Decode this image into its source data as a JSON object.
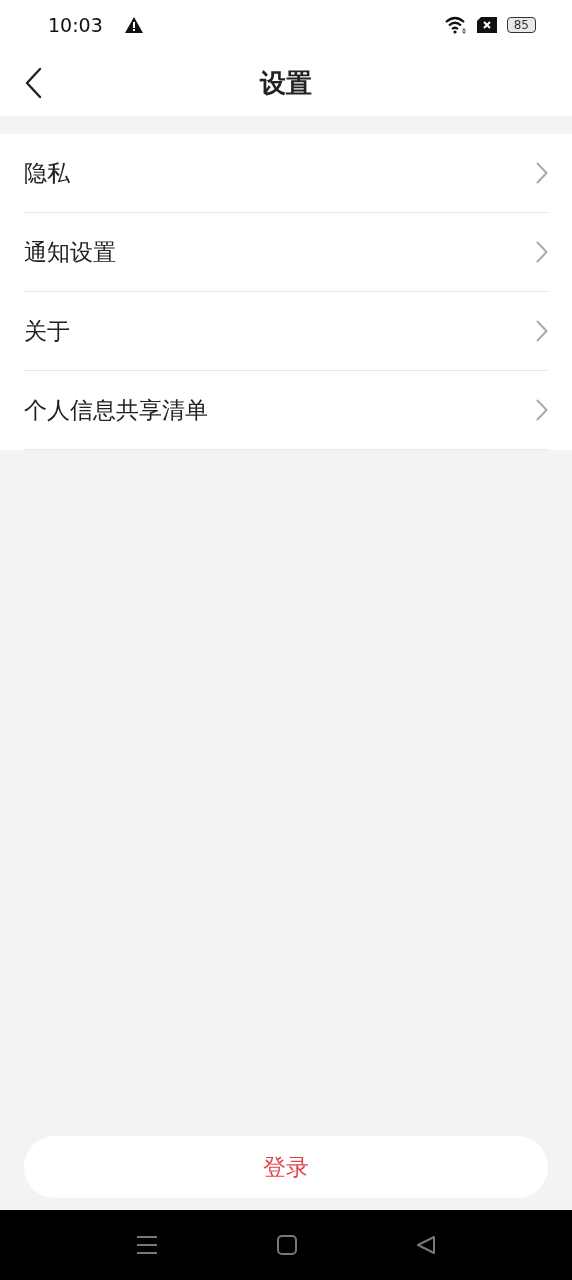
{
  "status_bar": {
    "time": "10:03",
    "battery": "85"
  },
  "header": {
    "title": "设置"
  },
  "menu": {
    "items": [
      {
        "label": "隐私"
      },
      {
        "label": "通知设置"
      },
      {
        "label": "关于"
      },
      {
        "label": "个人信息共享清单"
      }
    ]
  },
  "login_button": {
    "label": "登录"
  }
}
